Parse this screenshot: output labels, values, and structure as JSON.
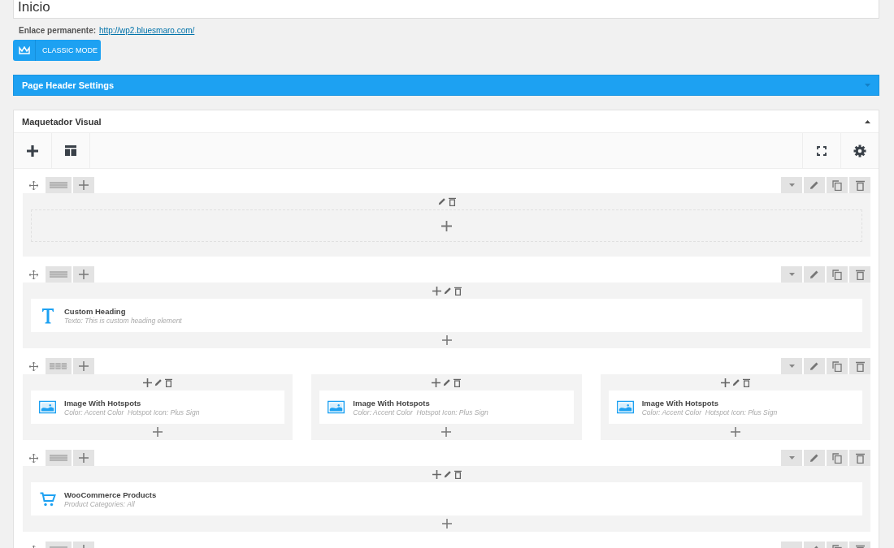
{
  "title_field": {
    "value": "Inicio"
  },
  "permalink": {
    "label": "Enlace permanente:",
    "url": "http://wp2.bluesmaro.com/"
  },
  "classic_mode_button": {
    "label": "CLASSIC MODE"
  },
  "page_header_settings": {
    "title": "Page Header Settings",
    "expanded": false
  },
  "builder": {
    "title": "Maquetador Visual",
    "expanded": true,
    "rows": [
      {
        "columns": [
          {}
        ]
      },
      {
        "columns": [
          {
            "elements": [
              {
                "kind": "heading",
                "title": "Custom Heading",
                "params": "Texto: This is custom heading element"
              }
            ]
          }
        ]
      },
      {
        "columns": [
          {
            "elements": [
              {
                "kind": "image",
                "title": "Image With Hotspots",
                "params": "Color: Accent Color  Hotspot Icon: Plus Sign"
              }
            ]
          },
          {
            "elements": [
              {
                "kind": "image",
                "title": "Image With Hotspots",
                "params": "Color: Accent Color  Hotspot Icon: Plus Sign"
              }
            ]
          },
          {
            "elements": [
              {
                "kind": "image",
                "title": "Image With Hotspots",
                "params": "Color: Accent Color  Hotspot Icon: Plus Sign"
              }
            ]
          }
        ]
      },
      {
        "columns": [
          {
            "elements": [
              {
                "kind": "cart",
                "title": "WooCommerce Products",
                "params": "Product Categories: All"
              }
            ]
          }
        ]
      },
      {
        "columns": [
          {}
        ]
      }
    ]
  }
}
